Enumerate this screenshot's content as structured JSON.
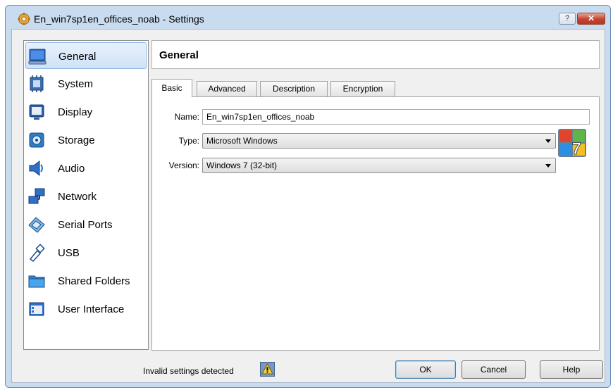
{
  "window": {
    "title": "En_win7sp1en_offices_noab - Settings",
    "help_label": "?",
    "close_label": "✕"
  },
  "sidebar": {
    "items": [
      {
        "label": "General",
        "icon": "general-icon",
        "selected": true
      },
      {
        "label": "System",
        "icon": "system-icon"
      },
      {
        "label": "Display",
        "icon": "display-icon"
      },
      {
        "label": "Storage",
        "icon": "storage-icon"
      },
      {
        "label": "Audio",
        "icon": "audio-icon"
      },
      {
        "label": "Network",
        "icon": "network-icon"
      },
      {
        "label": "Serial Ports",
        "icon": "serial-ports-icon"
      },
      {
        "label": "USB",
        "icon": "usb-icon"
      },
      {
        "label": "Shared Folders",
        "icon": "shared-folders-icon"
      },
      {
        "label": "User Interface",
        "icon": "user-interface-icon"
      }
    ]
  },
  "page": {
    "title": "General"
  },
  "tabs": [
    {
      "label": "Basic",
      "active": true
    },
    {
      "label": "Advanced"
    },
    {
      "label": "Description"
    },
    {
      "label": "Encryption"
    }
  ],
  "form": {
    "name_label": "Name:",
    "name_value": "En_win7sp1en_offices_noab",
    "type_label": "Type:",
    "type_value": "Microsoft Windows",
    "version_label": "Version:",
    "version_value": "Windows 7 (32-bit)",
    "os_logo_text": "7"
  },
  "footer": {
    "status": "Invalid settings detected",
    "ok_label": "OK",
    "cancel_label": "Cancel",
    "help_label": "Help"
  },
  "colors": {
    "frame": "#c9dcef",
    "selection": "#cfe2f8",
    "accent": "#3c7fb1"
  }
}
